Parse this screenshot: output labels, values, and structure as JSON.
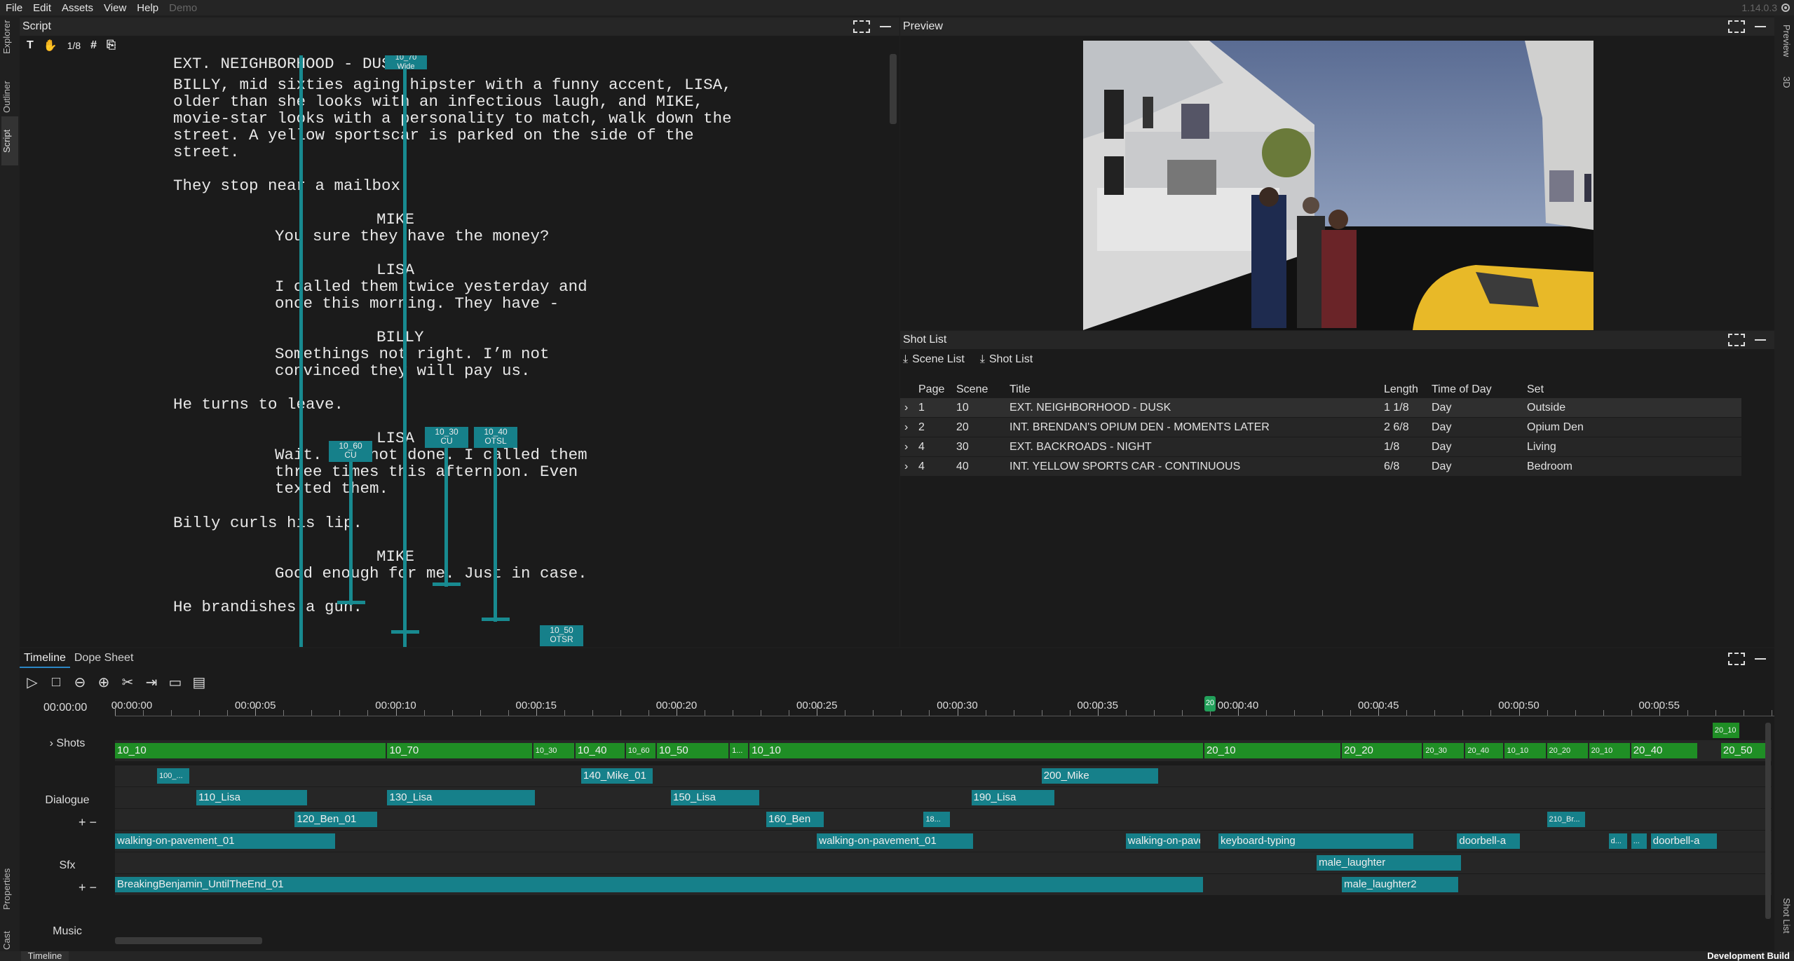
{
  "menu": {
    "items": [
      "File",
      "Edit",
      "Assets",
      "View",
      "Help"
    ],
    "project": "Demo",
    "version": "1.14.0.3"
  },
  "left_tabs": [
    "Explorer",
    "Outliner",
    "Script",
    "Properties",
    "Cast"
  ],
  "right_tabs": [
    "Preview",
    "3D",
    "Shot List"
  ],
  "script": {
    "title": "Script",
    "page_counter": "1/8",
    "lines": [
      {
        "kind": "action",
        "text": "EXT. NEIGHBORHOOD - DUSK"
      },
      {
        "kind": "action",
        "text": "BILLY, mid sixties aging hipster with a funny accent, LISA,"
      },
      {
        "kind": "action",
        "text": "older than she looks with an infectious laugh, and MIKE,"
      },
      {
        "kind": "action",
        "text": "movie-star looks with a personality to match, walk down the"
      },
      {
        "kind": "action",
        "text": "street. A yellow sportscar is parked on the side of the"
      },
      {
        "kind": "action",
        "text": "street."
      },
      {
        "kind": "action",
        "text": "They stop near a mailbox."
      },
      {
        "kind": "char",
        "text": "MIKE"
      },
      {
        "kind": "dialog",
        "text": "You sure they have the money?"
      },
      {
        "kind": "char",
        "text": "LISA"
      },
      {
        "kind": "dialog",
        "text": "I called them twice yesterday and"
      },
      {
        "kind": "dialog",
        "text": "once this morning. They have -"
      },
      {
        "kind": "char",
        "text": "BILLY"
      },
      {
        "kind": "dialog",
        "text": "Somethings not right. I’m not"
      },
      {
        "kind": "dialog",
        "text": "convinced they will pay us."
      },
      {
        "kind": "action",
        "text": "He turns to leave."
      },
      {
        "kind": "char",
        "text": "LISA"
      },
      {
        "kind": "dialog",
        "text": "Wait. I’m not done. I called them"
      },
      {
        "kind": "dialog",
        "text": "three times this afternoon. Even"
      },
      {
        "kind": "dialog",
        "text": "texted them."
      },
      {
        "kind": "action",
        "text": "Billy curls his lip."
      },
      {
        "kind": "char",
        "text": "MIKE"
      },
      {
        "kind": "dialog",
        "text": "Good enough for me. Just in case."
      },
      {
        "kind": "action",
        "text": "He brandishes a gun."
      }
    ],
    "shot_markers": [
      {
        "id": "10_70",
        "type": "Wide"
      },
      {
        "id": "10_60",
        "type": "CU"
      },
      {
        "id": "10_30",
        "type": "CU"
      },
      {
        "id": "10_40",
        "type": "OTSL"
      },
      {
        "id": "10_50",
        "type": "OTSR"
      }
    ]
  },
  "preview": {
    "title": "Preview"
  },
  "shotlist": {
    "title": "Shot List",
    "tabs": [
      "Scene List",
      "Shot  List"
    ],
    "columns": [
      "Page",
      "Scene",
      "Title",
      "Length",
      "Time of Day",
      "Set"
    ],
    "rows": [
      {
        "page": "1",
        "scene": "10",
        "title": "EXT. NEIGHBORHOOD - DUSK",
        "length": "1 1/8",
        "tod": "Day",
        "set": "Outside"
      },
      {
        "page": "2",
        "scene": "20",
        "title": "INT. BRENDAN'S OPIUM DEN - MOMENTS LATER",
        "length": "2 6/8",
        "tod": "Day",
        "set": "Opium Den"
      },
      {
        "page": "4",
        "scene": "30",
        "title": "EXT. BACKROADS - NIGHT",
        "length": "1/8",
        "tod": "Day",
        "set": "Living"
      },
      {
        "page": "4",
        "scene": "40",
        "title": "INT. YELLOW SPORTS CAR - CONTINUOUS",
        "length": "6/8",
        "tod": "Day",
        "set": "Bedroom"
      }
    ]
  },
  "timeline": {
    "tabs": [
      "Timeline",
      "Dope Sheet"
    ],
    "timecode": "00:00:00",
    "playhead_label": "20",
    "ruler_labels": [
      "00:00:00",
      "00:00:05",
      "00:00:10",
      "00:00:15",
      "00:00:20",
      "00:00:25",
      "00:00:30",
      "00:00:35",
      "00:00:40",
      "00:00:45",
      "00:00:50",
      "00:00:55"
    ],
    "tracks": {
      "shots": "Shots",
      "dialogue": "Dialogue",
      "sfx": "Sfx",
      "music": "Music"
    },
    "shot_clips_top": [
      {
        "label": "20_10",
        "start": 56.9,
        "end": 57.9
      }
    ],
    "shot_clips": [
      {
        "label": "10_10",
        "start": 0,
        "end": 9.7
      },
      {
        "label": "10_70",
        "start": 9.7,
        "end": 14.9
      },
      {
        "label": "10_30",
        "start": 14.9,
        "end": 16.4
      },
      {
        "label": "10_40",
        "start": 16.4,
        "end": 18.2
      },
      {
        "label": "10_60",
        "start": 18.2,
        "end": 19.3
      },
      {
        "label": "10_50",
        "start": 19.3,
        "end": 21.9
      },
      {
        "label": "1...",
        "start": 21.9,
        "end": 22.6
      },
      {
        "label": "10_10",
        "start": 22.6,
        "end": 38.8
      },
      {
        "label": "20_10",
        "start": 38.8,
        "end": 43.7
      },
      {
        "label": "20_20",
        "start": 43.7,
        "end": 46.6
      },
      {
        "label": "20_30",
        "start": 46.6,
        "end": 48.1
      },
      {
        "label": "20_40",
        "start": 48.1,
        "end": 49.5
      },
      {
        "label": "10_10",
        "start": 49.5,
        "end": 51
      },
      {
        "label": "20_20",
        "start": 51,
        "end": 52.5
      },
      {
        "label": "20_10",
        "start": 52.5,
        "end": 54
      },
      {
        "label": "20_40",
        "start": 54,
        "end": 56.4
      },
      {
        "label": "20_50",
        "start": 57.2,
        "end": 59
      }
    ],
    "dialogue_clips": [
      [
        {
          "label": "100_...",
          "start": 1.5,
          "end": 2.7
        },
        {
          "label": "140_Mike_01",
          "start": 16.6,
          "end": 19.2
        },
        {
          "label": "200_Mike",
          "start": 33,
          "end": 37.2
        }
      ],
      [
        {
          "label": "110_Lisa",
          "start": 2.9,
          "end": 6.9
        },
        {
          "label": "130_Lisa",
          "start": 9.7,
          "end": 15
        },
        {
          "label": "150_Lisa",
          "start": 19.8,
          "end": 23
        },
        {
          "label": "190_Lisa",
          "start": 30.5,
          "end": 33.5
        }
      ],
      [
        {
          "label": "120_Ben_01",
          "start": 6.4,
          "end": 9.4
        },
        {
          "label": "160_Ben",
          "start": 23.2,
          "end": 25.3
        },
        {
          "label": "18...",
          "start": 28.8,
          "end": 29.8
        },
        {
          "label": "210_Br...",
          "start": 51,
          "end": 52.4
        }
      ]
    ],
    "sfx_clips": [
      [
        {
          "label": "walking-on-pavement_01",
          "start": 0,
          "end": 7.9
        },
        {
          "label": "walking-on-pavement_01",
          "start": 25,
          "end": 30.6
        },
        {
          "label": "walking-on-pavem...",
          "start": 36,
          "end": 38.7
        },
        {
          "label": "keyboard-typing",
          "start": 39.3,
          "end": 46.3
        },
        {
          "label": "doorbell-a",
          "start": 47.8,
          "end": 50.1
        },
        {
          "label": "d...",
          "start": 53.2,
          "end": 53.9
        },
        {
          "label": "...",
          "start": 54,
          "end": 54.6
        },
        {
          "label": "doorbell-a",
          "start": 54.7,
          "end": 57.1
        }
      ],
      [
        {
          "label": "male_laughter",
          "start": 42.8,
          "end": 48
        }
      ]
    ],
    "music_clips": [
      [
        {
          "label": "BreakingBenjamin_UntilTheEnd_01",
          "start": 0,
          "end": 38.8
        },
        {
          "label": "male_laughter2",
          "start": 43.7,
          "end": 47.9
        }
      ]
    ]
  },
  "status": {
    "bottom_tab": "Timeline",
    "build": "Development Build"
  }
}
